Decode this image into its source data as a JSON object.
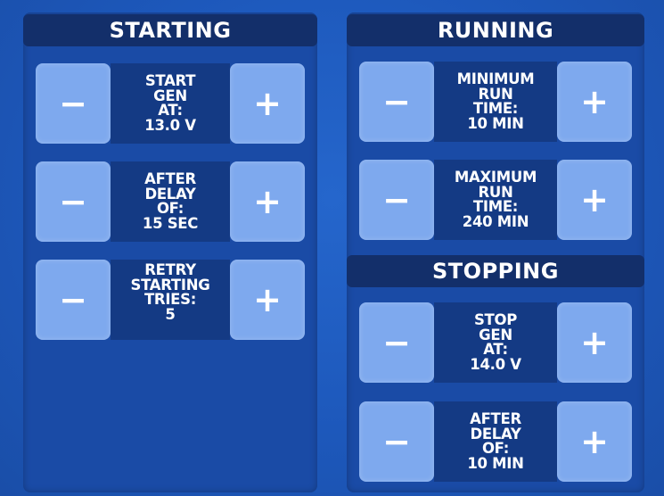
{
  "starting": {
    "title": "STARTING",
    "rows": [
      {
        "lines": [
          "START",
          "GEN",
          "AT:",
          "13.0 V"
        ],
        "minus": "−",
        "plus": "+"
      },
      {
        "lines": [
          "AFTER",
          "DELAY",
          "OF:",
          "15 SEC"
        ],
        "minus": "−",
        "plus": "+"
      },
      {
        "lines": [
          "RETRY",
          "STARTING",
          "TRIES:",
          "5"
        ],
        "minus": "−",
        "plus": "+"
      }
    ]
  },
  "running": {
    "title": "RUNNING",
    "rows": [
      {
        "lines": [
          "MINIMUM",
          "RUN",
          "TIME:",
          "10 MIN"
        ],
        "minus": "−",
        "plus": "+"
      },
      {
        "lines": [
          "MAXIMUM",
          "RUN",
          "TIME:",
          "240 MIN"
        ],
        "minus": "−",
        "plus": "+"
      }
    ]
  },
  "stopping": {
    "title": "STOPPING",
    "rows": [
      {
        "lines": [
          "STOP",
          "GEN",
          "AT:",
          "14.0 V"
        ],
        "minus": "−",
        "plus": "+"
      },
      {
        "lines": [
          "AFTER",
          "DELAY",
          "OF:",
          "10 MIN"
        ],
        "minus": "−",
        "plus": "+"
      }
    ]
  },
  "colors": {
    "background": "#1c55b8",
    "panel": "#1a4ba6",
    "header": "#132f6a",
    "button": "#7ea9ee",
    "label_block": "#143a84",
    "text": "#ffffff"
  },
  "icons": {
    "minus": "minus-icon",
    "plus": "plus-icon"
  }
}
